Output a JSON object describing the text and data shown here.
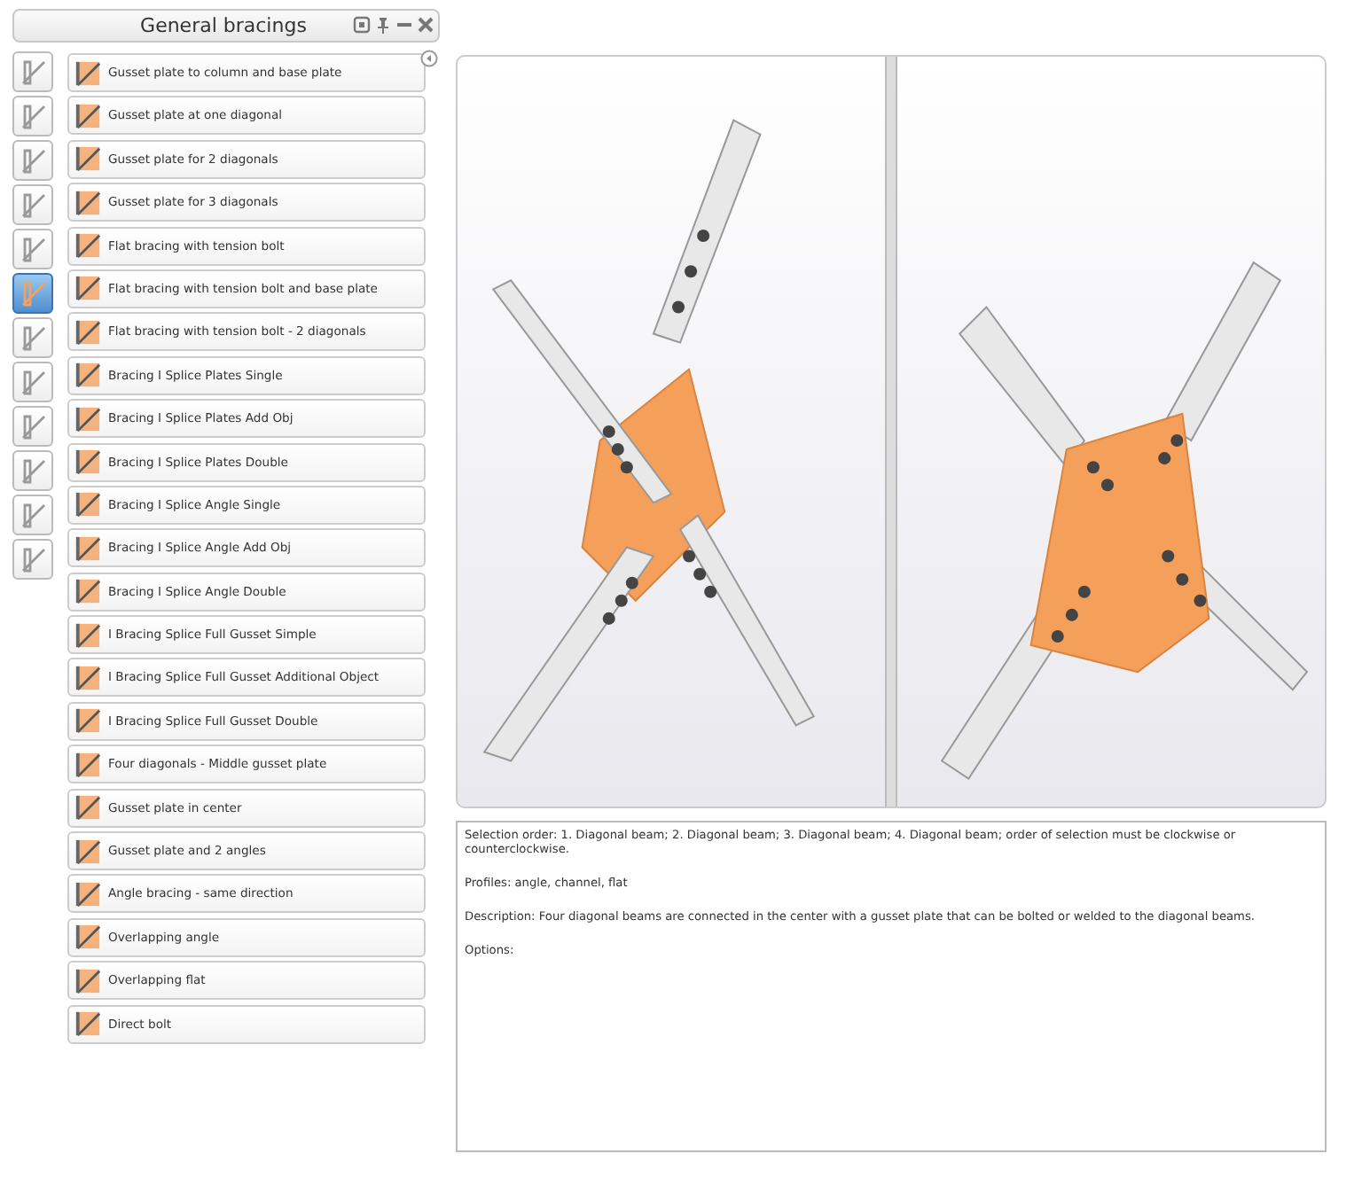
{
  "panel": {
    "title": "General bracings"
  },
  "categories": [
    {
      "selected": false
    },
    {
      "selected": false
    },
    {
      "selected": false
    },
    {
      "selected": false
    },
    {
      "selected": false
    },
    {
      "selected": true
    },
    {
      "selected": false
    },
    {
      "selected": false
    },
    {
      "selected": false
    },
    {
      "selected": false
    },
    {
      "selected": false
    },
    {
      "selected": false
    }
  ],
  "items": [
    {
      "label": "Gusset plate to column and base plate"
    },
    {
      "label": "Gusset plate at one diagonal"
    },
    {
      "label": "Gusset plate for 2 diagonals"
    },
    {
      "label": "Gusset plate for 3 diagonals"
    },
    {
      "label": "Flat bracing with tension bolt"
    },
    {
      "label": "Flat bracing with tension bolt and base plate"
    },
    {
      "label": "Flat bracing with tension bolt - 2 diagonals"
    },
    {
      "label": "Bracing I Splice Plates Single"
    },
    {
      "label": "Bracing I Splice Plates Add Obj"
    },
    {
      "label": "Bracing I Splice Plates Double"
    },
    {
      "label": "Bracing I Splice Angle Single"
    },
    {
      "label": "Bracing I Splice Angle Add Obj"
    },
    {
      "label": "Bracing I Splice Angle Double"
    },
    {
      "label": "I Bracing Splice Full Gusset Simple"
    },
    {
      "label": "I Bracing Splice Full Gusset Additional Object"
    },
    {
      "label": "I Bracing Splice Full Gusset Double"
    },
    {
      "label": "Four diagonals - Middle gusset plate"
    },
    {
      "label": "Gusset plate in center"
    },
    {
      "label": "Gusset plate and 2 angles"
    },
    {
      "label": "Angle bracing - same direction"
    },
    {
      "label": "Overlapping angle"
    },
    {
      "label": "Overlapping flat"
    },
    {
      "label": "Direct bolt"
    }
  ],
  "description": [
    "Selection order: 1. Diagonal beam; 2. Diagonal beam; 3. Diagonal beam; 4. Diagonal beam; order of selection must be clockwise or counterclockwise.",
    "Profiles: angle, channel, flat",
    "Description: Four diagonal beams are connected in the center with a gusset plate that can be bolted or welded to the diagonal beams.",
    "Options:"
  ]
}
